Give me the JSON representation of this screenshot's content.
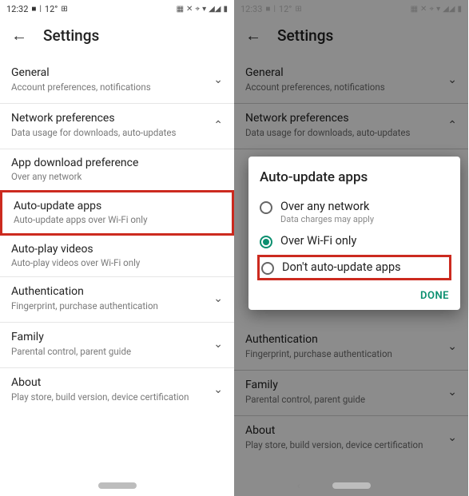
{
  "status": {
    "timeL": "12:32",
    "timeR": "12:33",
    "temp": "12°"
  },
  "header": {
    "title": "Settings"
  },
  "sections": {
    "general": {
      "title": "General",
      "sub": "Account preferences, notifications"
    },
    "network": {
      "title": "Network preferences",
      "sub": "Data usage for downloads, auto-updates"
    },
    "download": {
      "title": "App download preference",
      "sub": "Over any network"
    },
    "autoupdate": {
      "title": "Auto-update apps",
      "sub": "Auto-update apps over Wi-Fi only"
    },
    "autoplay": {
      "title": "Auto-play videos",
      "sub": "Auto-play videos over Wi-Fi only"
    },
    "auth": {
      "title": "Authentication",
      "sub": "Fingerprint, purchase authentication"
    },
    "family": {
      "title": "Family",
      "sub": "Parental control, parent guide"
    },
    "about": {
      "title": "About",
      "sub": "Play store, build version, device certification"
    }
  },
  "dialog": {
    "title": "Auto-update apps",
    "opts": [
      {
        "label": "Over any network",
        "sub": "Data charges may apply"
      },
      {
        "label": "Over Wi-Fi only",
        "sub": ""
      },
      {
        "label": "Don't auto-update apps",
        "sub": ""
      }
    ],
    "done": "DONE"
  }
}
